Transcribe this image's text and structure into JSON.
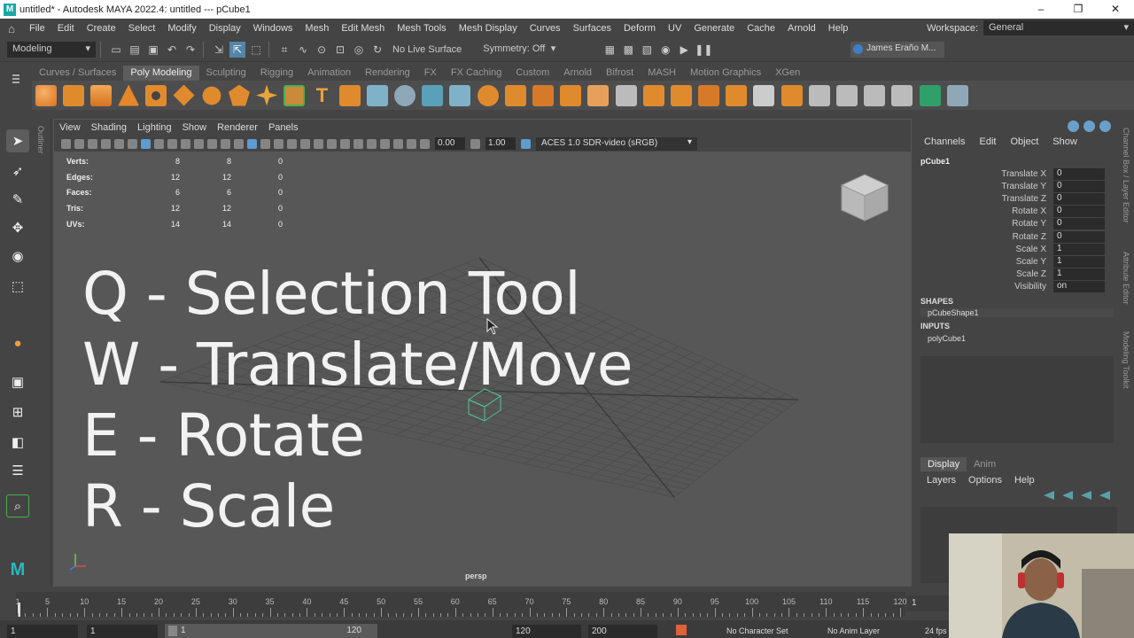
{
  "window": {
    "title": "untitled* - Autodesk MAYA 2022.4: untitled   ---   pCube1",
    "controls": [
      "–",
      "❐",
      "✕"
    ]
  },
  "menubar": {
    "items": [
      "File",
      "Edit",
      "Create",
      "Select",
      "Modify",
      "Display",
      "Windows",
      "Mesh",
      "Edit Mesh",
      "Mesh Tools",
      "Mesh Display",
      "Curves",
      "Surfaces",
      "Deform",
      "UV",
      "Generate",
      "Cache",
      "Arnold",
      "Help"
    ],
    "workspace_label": "Workspace:",
    "workspace_value": "General"
  },
  "statusline": {
    "mode": "Modeling",
    "live_surface": "No Live Surface",
    "symmetry": "Symmetry: Off",
    "user": "James Eraño M..."
  },
  "shelf": {
    "tabs": [
      "Curves / Surfaces",
      "Poly Modeling",
      "Sculpting",
      "Rigging",
      "Animation",
      "Rendering",
      "FX",
      "FX Caching",
      "Custom",
      "Arnold",
      "Bifrost",
      "MASH",
      "Motion Graphics",
      "XGen"
    ],
    "active_tab": "Poly Modeling"
  },
  "viewport": {
    "menu": [
      "View",
      "Shading",
      "Lighting",
      "Show",
      "Renderer",
      "Panels"
    ],
    "exposure": "0.00",
    "gamma": "1.00",
    "color_management": "ACES 1.0 SDR-video (sRGB)",
    "hud": [
      {
        "label": "Verts:",
        "a": "8",
        "b": "8",
        "c": "0"
      },
      {
        "label": "Edges:",
        "a": "12",
        "b": "12",
        "c": "0"
      },
      {
        "label": "Faces:",
        "a": "6",
        "b": "6",
        "c": "0"
      },
      {
        "label": "Tris:",
        "a": "12",
        "b": "12",
        "c": "0"
      },
      {
        "label": "UVs:",
        "a": "14",
        "b": "14",
        "c": "0"
      }
    ],
    "overlay": {
      "line1": "Q - Selection Tool",
      "line2": "W - Translate/Move",
      "line3": "E - Rotate",
      "line4": "R - Scale"
    },
    "camera": "persp"
  },
  "outliner_label": "Outliner",
  "channel_box": {
    "menu": [
      "Channels",
      "Edit",
      "Object",
      "Show"
    ],
    "object": "pCube1",
    "attributes": [
      {
        "name": "Translate X",
        "value": "0"
      },
      {
        "name": "Translate Y",
        "value": "0"
      },
      {
        "name": "Translate Z",
        "value": "0"
      },
      {
        "name": "Rotate X",
        "value": "0"
      },
      {
        "name": "Rotate Y",
        "value": "0"
      },
      {
        "name": "Rotate Z",
        "value": "0"
      },
      {
        "name": "Scale X",
        "value": "1"
      },
      {
        "name": "Scale Y",
        "value": "1"
      },
      {
        "name": "Scale Z",
        "value": "1"
      },
      {
        "name": "Visibility",
        "value": "on"
      }
    ],
    "shapes_label": "SHAPES",
    "shape_node": "pCubeShape1",
    "inputs_label": "INPUTS",
    "input_node": "polyCube1"
  },
  "layer_editor": {
    "tabs": [
      "Display",
      "Anim"
    ],
    "menu": [
      "Layers",
      "Options",
      "Help"
    ]
  },
  "side_strip": [
    "Channel Box / Layer Editor",
    "Attribute Editor",
    "Modeling Toolkit"
  ],
  "timeslider": {
    "ticks": [
      "1",
      "5",
      "10",
      "15",
      "20",
      "25",
      "30",
      "35",
      "40",
      "45",
      "50",
      "55",
      "60",
      "65",
      "70",
      "75",
      "80",
      "85",
      "90",
      "95",
      "100",
      "105",
      "110",
      "115",
      "120"
    ],
    "current_frame": "1"
  },
  "rangebar": {
    "start": "1",
    "anim_start": "1",
    "range_start": "1",
    "range_end": "120",
    "anim_end": "120",
    "end": "200",
    "character_set": "No Character Set",
    "anim_layer": "No Anim Layer",
    "fps": "24 fps"
  }
}
